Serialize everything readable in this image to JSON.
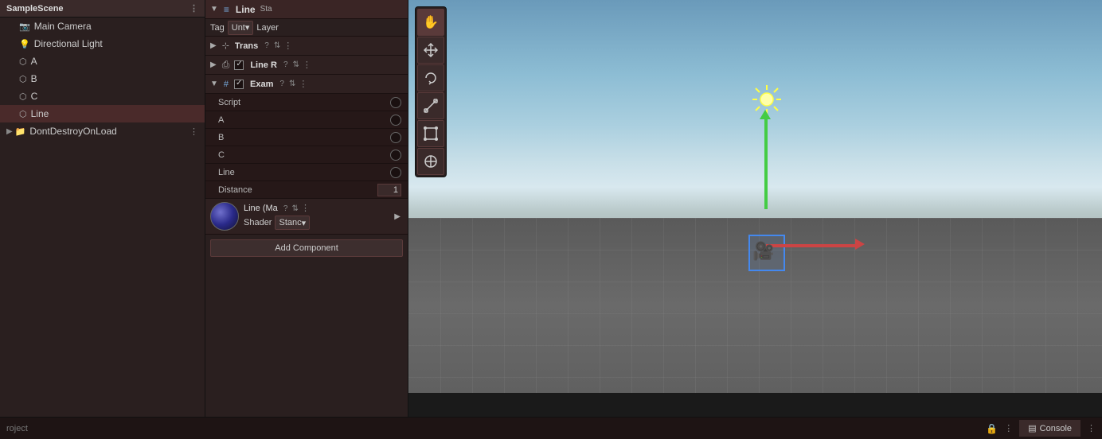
{
  "hierarchy": {
    "title": "SampleScene",
    "items": [
      {
        "id": "main-camera",
        "label": "Main Camera",
        "indent": 1,
        "icon": "📷",
        "selected": false
      },
      {
        "id": "directional-light",
        "label": "Directional Light",
        "indent": 1,
        "icon": "💡",
        "selected": false
      },
      {
        "id": "a",
        "label": "A",
        "indent": 1,
        "icon": "⬡",
        "selected": false
      },
      {
        "id": "b",
        "label": "B",
        "indent": 1,
        "icon": "⬡",
        "selected": false
      },
      {
        "id": "c",
        "label": "C",
        "indent": 1,
        "icon": "⬡",
        "selected": false
      },
      {
        "id": "line",
        "label": "Line",
        "indent": 1,
        "icon": "⬡",
        "selected": true
      },
      {
        "id": "dont-destroy",
        "label": "DontDestroyOnLoad",
        "indent": 0,
        "icon": "📂",
        "selected": false
      }
    ]
  },
  "inspector": {
    "tag_label": "Tag",
    "tag_value": "Unt",
    "layer_label": "Layer",
    "transform_label": "Trans",
    "line_renderer_label": "Line R",
    "example_label": "Exam",
    "script_label": "Script",
    "a_label": "A",
    "b_label": "B",
    "c_label": "C",
    "line_label": "Line",
    "distance_label": "Distance",
    "distance_value": "1",
    "material_name": "Line (Ma",
    "shader_label": "Shader",
    "shader_value": "Stanc",
    "add_component_label": "Add Component"
  },
  "toolbar": {
    "tools": [
      {
        "id": "hand",
        "icon": "✋",
        "label": "hand-tool",
        "active": true
      },
      {
        "id": "move",
        "icon": "✛",
        "label": "move-tool",
        "active": false
      },
      {
        "id": "rotate",
        "icon": "↻",
        "label": "rotate-tool",
        "active": false
      },
      {
        "id": "scale",
        "icon": "⤢",
        "label": "scale-tool",
        "active": false
      },
      {
        "id": "rect",
        "icon": "▣",
        "label": "rect-tool",
        "active": false
      },
      {
        "id": "transform",
        "icon": "⊕",
        "label": "transform-tool",
        "active": false
      }
    ]
  },
  "statusbar": {
    "project_label": "roject",
    "lock_icon": "🔒",
    "console_label": "Console",
    "dots": "⋮"
  },
  "colors": {
    "accent_blue": "#4488ee",
    "arrow_green": "#44cc44",
    "arrow_red": "#cc4444",
    "panel_bg": "#2a1f1f",
    "selected_bg": "#4a2a2a"
  }
}
